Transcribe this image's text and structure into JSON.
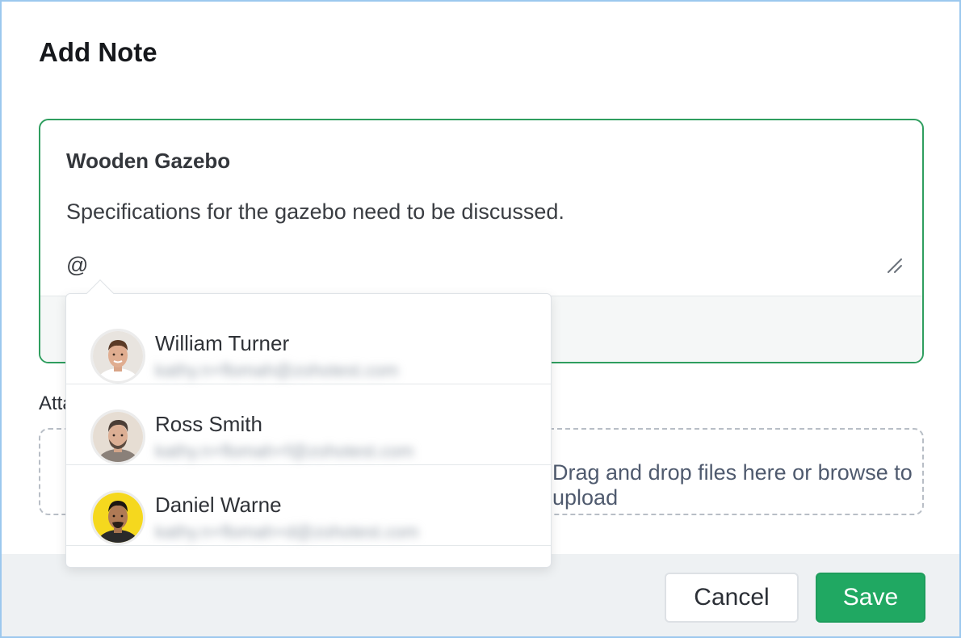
{
  "modal": {
    "title": "Add Note"
  },
  "note": {
    "title": "Wooden Gazebo",
    "body": "Specifications for the gazebo need to be discussed.",
    "mention_input": "@"
  },
  "attachments": {
    "label": "Attachments",
    "dropzone_text": "Drag and drop files here or browse to upload"
  },
  "mention_suggestions": [
    {
      "name": "William Turner",
      "email": "kathy.n+flomah@zohotest.com"
    },
    {
      "name": "Ross Smith",
      "email": "kathy.n+flomah+f@zohotest.com"
    },
    {
      "name": "Daniel Warne",
      "email": "kathy.n+flomah+d@zohotest.com"
    }
  ],
  "footer": {
    "cancel_label": "Cancel",
    "save_label": "Save"
  },
  "colors": {
    "accent_green": "#20a862",
    "editor_border": "#2f9e5f",
    "frame_border": "#9cc8ee"
  },
  "icons": {
    "resize": "resize-handle-icon"
  }
}
